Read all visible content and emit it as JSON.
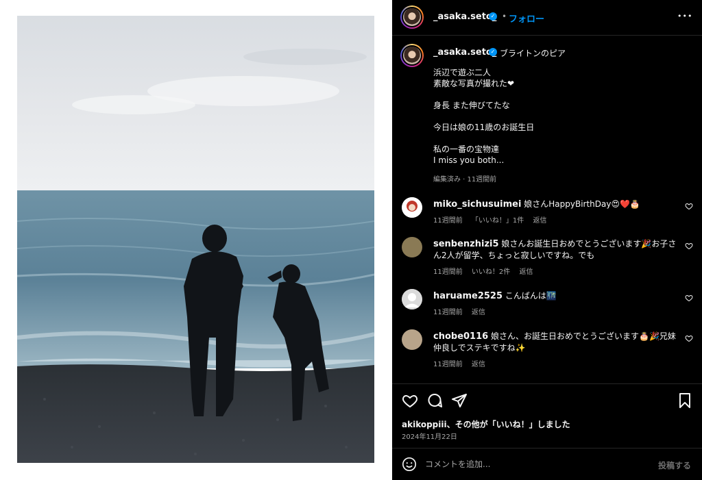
{
  "post": {
    "username": "_asaka.seto_",
    "follow_label": "フォロー",
    "separator": "•",
    "more_label": "•••"
  },
  "caption": {
    "username": "_asaka.seto_",
    "location": "ブライトンのピア",
    "lines": [
      "浜辺で遊ぶ二人",
      "素敵な写真が撮れた❤",
      "",
      "身長 また伸びてたな",
      "",
      "今日は娘の11歳のお誕生日",
      "",
      "私の一番の宝物達",
      "I miss you both..."
    ],
    "meta": "編集済み · 11週間前"
  },
  "comments": [
    {
      "username": "miko_sichusuimei",
      "text": "娘さんHappyBirthDay😍❤️🎂",
      "time": "11週間前",
      "likes": "「いいね！」1件",
      "reply": "返信",
      "avatar_color": "#c0392b"
    },
    {
      "username": "senbenzhizi5",
      "text": "娘さんお誕生日おめでとうございます🎉お子さん2人が留学、ちょっと寂しいですね。でも",
      "time": "11週間前",
      "likes": "いいね！2件",
      "reply": "返信",
      "avatar_color": "#8a7a55"
    },
    {
      "username": "haruame2525",
      "text": "こんばんは🌃",
      "time": "11週間前",
      "likes": "",
      "reply": "返信",
      "avatar_color": "#dbdbdb"
    },
    {
      "username": "chobe0116",
      "text": "娘さん、お誕生日おめでとうございます🎂🎉兄妹仲良しでステキですね✨",
      "time": "11週間前",
      "likes": "",
      "reply": "返信",
      "avatar_color": "#b8a48a"
    }
  ],
  "actions": {
    "likes_text": "akikoppiii、その他が「いいね！」しました",
    "date": "2024年11月22日"
  },
  "compose": {
    "placeholder": "コメントを追加...",
    "post_label": "投稿する"
  },
  "colors": {
    "accent": "#0095f6",
    "panel_bg": "#000000",
    "muted": "#a8a8a8"
  }
}
